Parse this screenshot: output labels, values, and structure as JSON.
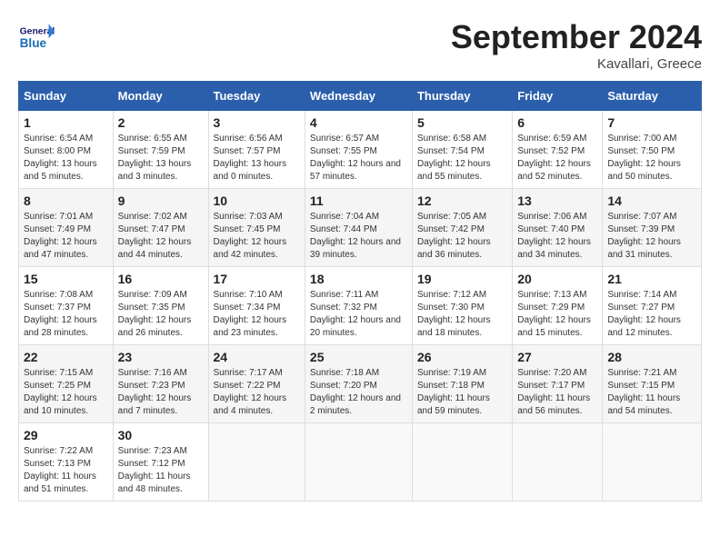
{
  "logo": {
    "general": "General",
    "blue": "Blue"
  },
  "title": "September 2024",
  "location": "Kavallari, Greece",
  "days_of_week": [
    "Sunday",
    "Monday",
    "Tuesday",
    "Wednesday",
    "Thursday",
    "Friday",
    "Saturday"
  ],
  "weeks": [
    [
      {
        "day": "1",
        "sunrise": "6:54 AM",
        "sunset": "8:00 PM",
        "daylight": "13 hours and 5 minutes."
      },
      {
        "day": "2",
        "sunrise": "6:55 AM",
        "sunset": "7:59 PM",
        "daylight": "13 hours and 3 minutes."
      },
      {
        "day": "3",
        "sunrise": "6:56 AM",
        "sunset": "7:57 PM",
        "daylight": "13 hours and 0 minutes."
      },
      {
        "day": "4",
        "sunrise": "6:57 AM",
        "sunset": "7:55 PM",
        "daylight": "12 hours and 57 minutes."
      },
      {
        "day": "5",
        "sunrise": "6:58 AM",
        "sunset": "7:54 PM",
        "daylight": "12 hours and 55 minutes."
      },
      {
        "day": "6",
        "sunrise": "6:59 AM",
        "sunset": "7:52 PM",
        "daylight": "12 hours and 52 minutes."
      },
      {
        "day": "7",
        "sunrise": "7:00 AM",
        "sunset": "7:50 PM",
        "daylight": "12 hours and 50 minutes."
      }
    ],
    [
      {
        "day": "8",
        "sunrise": "7:01 AM",
        "sunset": "7:49 PM",
        "daylight": "12 hours and 47 minutes."
      },
      {
        "day": "9",
        "sunrise": "7:02 AM",
        "sunset": "7:47 PM",
        "daylight": "12 hours and 44 minutes."
      },
      {
        "day": "10",
        "sunrise": "7:03 AM",
        "sunset": "7:45 PM",
        "daylight": "12 hours and 42 minutes."
      },
      {
        "day": "11",
        "sunrise": "7:04 AM",
        "sunset": "7:44 PM",
        "daylight": "12 hours and 39 minutes."
      },
      {
        "day": "12",
        "sunrise": "7:05 AM",
        "sunset": "7:42 PM",
        "daylight": "12 hours and 36 minutes."
      },
      {
        "day": "13",
        "sunrise": "7:06 AM",
        "sunset": "7:40 PM",
        "daylight": "12 hours and 34 minutes."
      },
      {
        "day": "14",
        "sunrise": "7:07 AM",
        "sunset": "7:39 PM",
        "daylight": "12 hours and 31 minutes."
      }
    ],
    [
      {
        "day": "15",
        "sunrise": "7:08 AM",
        "sunset": "7:37 PM",
        "daylight": "12 hours and 28 minutes."
      },
      {
        "day": "16",
        "sunrise": "7:09 AM",
        "sunset": "7:35 PM",
        "daylight": "12 hours and 26 minutes."
      },
      {
        "day": "17",
        "sunrise": "7:10 AM",
        "sunset": "7:34 PM",
        "daylight": "12 hours and 23 minutes."
      },
      {
        "day": "18",
        "sunrise": "7:11 AM",
        "sunset": "7:32 PM",
        "daylight": "12 hours and 20 minutes."
      },
      {
        "day": "19",
        "sunrise": "7:12 AM",
        "sunset": "7:30 PM",
        "daylight": "12 hours and 18 minutes."
      },
      {
        "day": "20",
        "sunrise": "7:13 AM",
        "sunset": "7:29 PM",
        "daylight": "12 hours and 15 minutes."
      },
      {
        "day": "21",
        "sunrise": "7:14 AM",
        "sunset": "7:27 PM",
        "daylight": "12 hours and 12 minutes."
      }
    ],
    [
      {
        "day": "22",
        "sunrise": "7:15 AM",
        "sunset": "7:25 PM",
        "daylight": "12 hours and 10 minutes."
      },
      {
        "day": "23",
        "sunrise": "7:16 AM",
        "sunset": "7:23 PM",
        "daylight": "12 hours and 7 minutes."
      },
      {
        "day": "24",
        "sunrise": "7:17 AM",
        "sunset": "7:22 PM",
        "daylight": "12 hours and 4 minutes."
      },
      {
        "day": "25",
        "sunrise": "7:18 AM",
        "sunset": "7:20 PM",
        "daylight": "12 hours and 2 minutes."
      },
      {
        "day": "26",
        "sunrise": "7:19 AM",
        "sunset": "7:18 PM",
        "daylight": "11 hours and 59 minutes."
      },
      {
        "day": "27",
        "sunrise": "7:20 AM",
        "sunset": "7:17 PM",
        "daylight": "11 hours and 56 minutes."
      },
      {
        "day": "28",
        "sunrise": "7:21 AM",
        "sunset": "7:15 PM",
        "daylight": "11 hours and 54 minutes."
      }
    ],
    [
      {
        "day": "29",
        "sunrise": "7:22 AM",
        "sunset": "7:13 PM",
        "daylight": "11 hours and 51 minutes."
      },
      {
        "day": "30",
        "sunrise": "7:23 AM",
        "sunset": "7:12 PM",
        "daylight": "11 hours and 48 minutes."
      },
      null,
      null,
      null,
      null,
      null
    ]
  ]
}
